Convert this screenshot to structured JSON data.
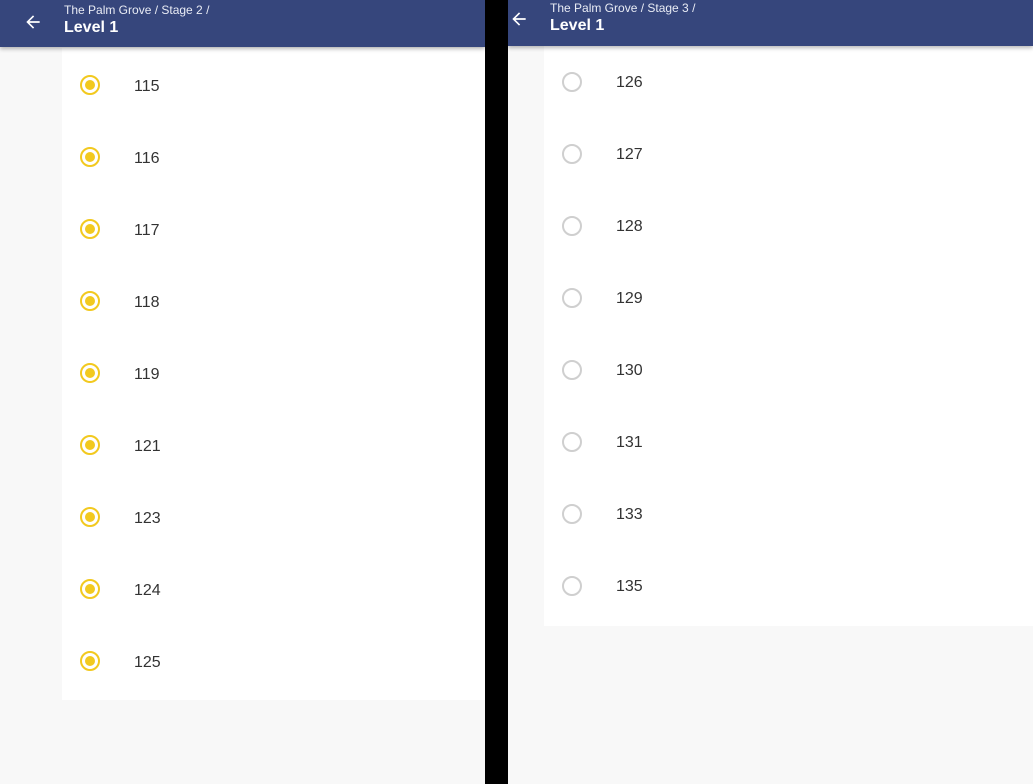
{
  "left": {
    "breadcrumb": "The Palm Grove / Stage 2 /",
    "title": "Level 1",
    "items": [
      {
        "label": "115",
        "checked": true
      },
      {
        "label": "116",
        "checked": true
      },
      {
        "label": "117",
        "checked": true
      },
      {
        "label": "118",
        "checked": true
      },
      {
        "label": "119",
        "checked": true
      },
      {
        "label": "121",
        "checked": true
      },
      {
        "label": "123",
        "checked": true
      },
      {
        "label": "124",
        "checked": true
      },
      {
        "label": "125",
        "checked": true
      }
    ]
  },
  "right": {
    "breadcrumb": "The Palm Grove / Stage 3 /",
    "title": "Level 1",
    "items": [
      {
        "label": "126",
        "checked": false
      },
      {
        "label": "127",
        "checked": false
      },
      {
        "label": "128",
        "checked": false
      },
      {
        "label": "129",
        "checked": false
      },
      {
        "label": "130",
        "checked": false
      },
      {
        "label": "131",
        "checked": false
      },
      {
        "label": "133",
        "checked": false
      },
      {
        "label": "135",
        "checked": false
      }
    ]
  },
  "colors": {
    "appbar": "#36467c",
    "radio_checked": "#f2c91f",
    "radio_unchecked": "#cfcfcf"
  },
  "icons": {
    "back": "arrow-left-icon",
    "radio": "radio-button-icon"
  }
}
